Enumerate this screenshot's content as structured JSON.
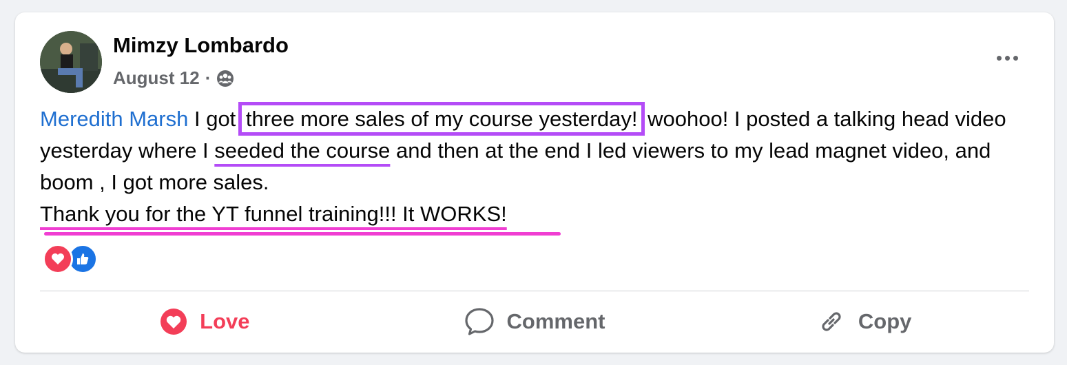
{
  "post": {
    "author": "Mimzy Lombardo",
    "date": "August 12",
    "separator": "·",
    "audience_icon": "group-icon",
    "more_icon": "more-options-icon"
  },
  "body": {
    "mention": "Meredith Marsh",
    "seg1": " I got ",
    "highlight_box": "three more sales of my course yesterday!",
    "seg2": " woohoo! I posted a talking head video yesterday where I ",
    "highlight_underline": "seeded the course",
    "seg3": " and then at the end I led viewers to my lead magnet video, and boom , I got more sales.",
    "line2": "Thank you for the YT funnel training!!! It WORKS!"
  },
  "reactions": [
    "love-reaction-icon",
    "like-reaction-icon"
  ],
  "actions": {
    "love": "Love",
    "comment": "Comment",
    "copy": "Copy"
  },
  "colors": {
    "mention": "#1f6fd0",
    "highlight_box": "#b44cf7",
    "highlight_underline_pink": "#f03ed2",
    "love": "#f33e58",
    "like": "#1b74e4"
  }
}
